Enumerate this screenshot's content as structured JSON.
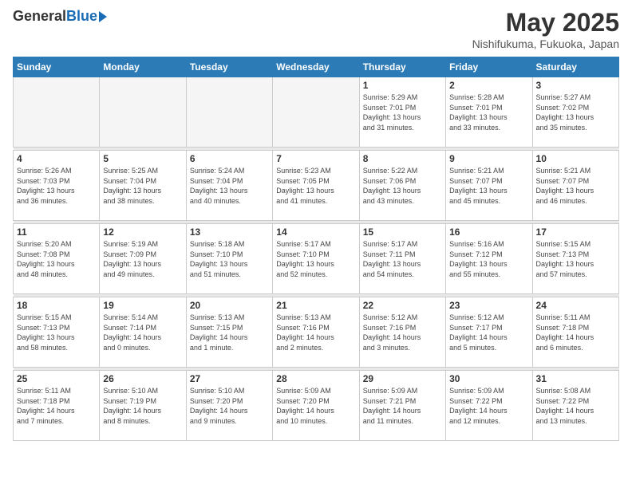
{
  "header": {
    "logo_general": "General",
    "logo_blue": "Blue",
    "month_title": "May 2025",
    "location": "Nishifukuma, Fukuoka, Japan"
  },
  "weekdays": [
    "Sunday",
    "Monday",
    "Tuesday",
    "Wednesday",
    "Thursday",
    "Friday",
    "Saturday"
  ],
  "weeks": [
    [
      {
        "day": "",
        "info": ""
      },
      {
        "day": "",
        "info": ""
      },
      {
        "day": "",
        "info": ""
      },
      {
        "day": "",
        "info": ""
      },
      {
        "day": "1",
        "info": "Sunrise: 5:29 AM\nSunset: 7:01 PM\nDaylight: 13 hours\nand 31 minutes."
      },
      {
        "day": "2",
        "info": "Sunrise: 5:28 AM\nSunset: 7:01 PM\nDaylight: 13 hours\nand 33 minutes."
      },
      {
        "day": "3",
        "info": "Sunrise: 5:27 AM\nSunset: 7:02 PM\nDaylight: 13 hours\nand 35 minutes."
      }
    ],
    [
      {
        "day": "4",
        "info": "Sunrise: 5:26 AM\nSunset: 7:03 PM\nDaylight: 13 hours\nand 36 minutes."
      },
      {
        "day": "5",
        "info": "Sunrise: 5:25 AM\nSunset: 7:04 PM\nDaylight: 13 hours\nand 38 minutes."
      },
      {
        "day": "6",
        "info": "Sunrise: 5:24 AM\nSunset: 7:04 PM\nDaylight: 13 hours\nand 40 minutes."
      },
      {
        "day": "7",
        "info": "Sunrise: 5:23 AM\nSunset: 7:05 PM\nDaylight: 13 hours\nand 41 minutes."
      },
      {
        "day": "8",
        "info": "Sunrise: 5:22 AM\nSunset: 7:06 PM\nDaylight: 13 hours\nand 43 minutes."
      },
      {
        "day": "9",
        "info": "Sunrise: 5:21 AM\nSunset: 7:07 PM\nDaylight: 13 hours\nand 45 minutes."
      },
      {
        "day": "10",
        "info": "Sunrise: 5:21 AM\nSunset: 7:07 PM\nDaylight: 13 hours\nand 46 minutes."
      }
    ],
    [
      {
        "day": "11",
        "info": "Sunrise: 5:20 AM\nSunset: 7:08 PM\nDaylight: 13 hours\nand 48 minutes."
      },
      {
        "day": "12",
        "info": "Sunrise: 5:19 AM\nSunset: 7:09 PM\nDaylight: 13 hours\nand 49 minutes."
      },
      {
        "day": "13",
        "info": "Sunrise: 5:18 AM\nSunset: 7:10 PM\nDaylight: 13 hours\nand 51 minutes."
      },
      {
        "day": "14",
        "info": "Sunrise: 5:17 AM\nSunset: 7:10 PM\nDaylight: 13 hours\nand 52 minutes."
      },
      {
        "day": "15",
        "info": "Sunrise: 5:17 AM\nSunset: 7:11 PM\nDaylight: 13 hours\nand 54 minutes."
      },
      {
        "day": "16",
        "info": "Sunrise: 5:16 AM\nSunset: 7:12 PM\nDaylight: 13 hours\nand 55 minutes."
      },
      {
        "day": "17",
        "info": "Sunrise: 5:15 AM\nSunset: 7:13 PM\nDaylight: 13 hours\nand 57 minutes."
      }
    ],
    [
      {
        "day": "18",
        "info": "Sunrise: 5:15 AM\nSunset: 7:13 PM\nDaylight: 13 hours\nand 58 minutes."
      },
      {
        "day": "19",
        "info": "Sunrise: 5:14 AM\nSunset: 7:14 PM\nDaylight: 14 hours\nand 0 minutes."
      },
      {
        "day": "20",
        "info": "Sunrise: 5:13 AM\nSunset: 7:15 PM\nDaylight: 14 hours\nand 1 minute."
      },
      {
        "day": "21",
        "info": "Sunrise: 5:13 AM\nSunset: 7:16 PM\nDaylight: 14 hours\nand 2 minutes."
      },
      {
        "day": "22",
        "info": "Sunrise: 5:12 AM\nSunset: 7:16 PM\nDaylight: 14 hours\nand 3 minutes."
      },
      {
        "day": "23",
        "info": "Sunrise: 5:12 AM\nSunset: 7:17 PM\nDaylight: 14 hours\nand 5 minutes."
      },
      {
        "day": "24",
        "info": "Sunrise: 5:11 AM\nSunset: 7:18 PM\nDaylight: 14 hours\nand 6 minutes."
      }
    ],
    [
      {
        "day": "25",
        "info": "Sunrise: 5:11 AM\nSunset: 7:18 PM\nDaylight: 14 hours\nand 7 minutes."
      },
      {
        "day": "26",
        "info": "Sunrise: 5:10 AM\nSunset: 7:19 PM\nDaylight: 14 hours\nand 8 minutes."
      },
      {
        "day": "27",
        "info": "Sunrise: 5:10 AM\nSunset: 7:20 PM\nDaylight: 14 hours\nand 9 minutes."
      },
      {
        "day": "28",
        "info": "Sunrise: 5:09 AM\nSunset: 7:20 PM\nDaylight: 14 hours\nand 10 minutes."
      },
      {
        "day": "29",
        "info": "Sunrise: 5:09 AM\nSunset: 7:21 PM\nDaylight: 14 hours\nand 11 minutes."
      },
      {
        "day": "30",
        "info": "Sunrise: 5:09 AM\nSunset: 7:22 PM\nDaylight: 14 hours\nand 12 minutes."
      },
      {
        "day": "31",
        "info": "Sunrise: 5:08 AM\nSunset: 7:22 PM\nDaylight: 14 hours\nand 13 minutes."
      }
    ]
  ]
}
